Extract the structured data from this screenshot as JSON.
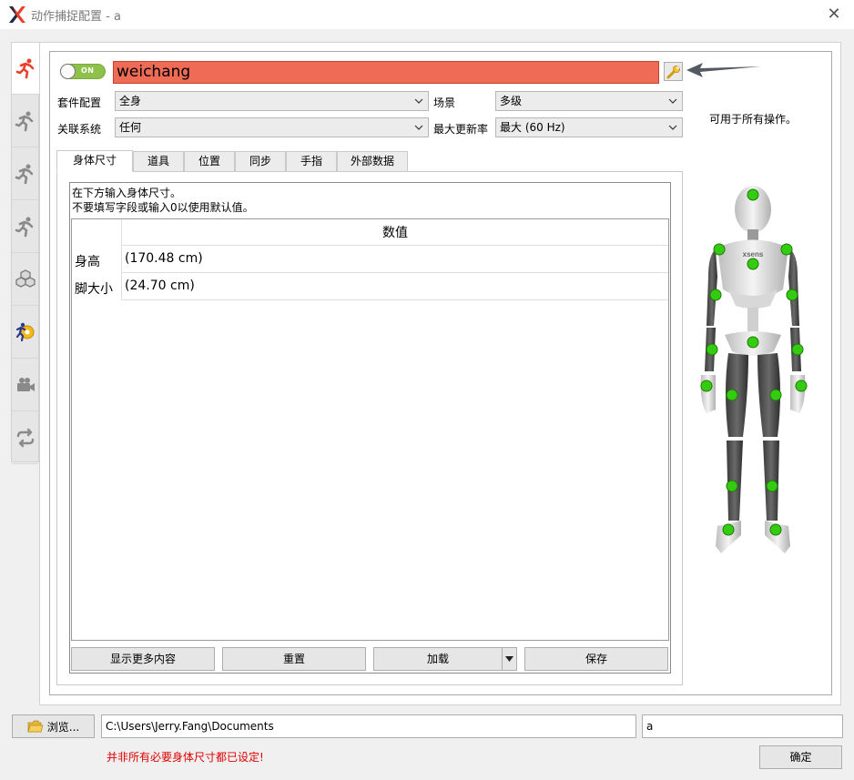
{
  "window": {
    "title": "动作捕捉配置 - a",
    "close_glyph": "✕"
  },
  "side_tabs": [
    {
      "icon": "running-figure-red-icon",
      "active": true
    },
    {
      "icon": "running-figure-gray-icon",
      "active": false
    },
    {
      "icon": "running-figure-gray-icon",
      "active": false
    },
    {
      "icon": "running-figure-gray-icon",
      "active": false
    },
    {
      "icon": "cubes-icon",
      "active": false
    },
    {
      "icon": "running-figure-gear-icon",
      "active": false
    },
    {
      "icon": "video-camera-icon",
      "active": false
    },
    {
      "icon": "sync-arrows-icon",
      "active": false
    }
  ],
  "header": {
    "toggle_label": "ON",
    "name_value": "weichang",
    "name_bg_color": "#ee6b55"
  },
  "config": {
    "suit_label": "套件配置",
    "suit_value": "全身",
    "scene_label": "场景",
    "scene_value": "多级",
    "link_label": "关联系统",
    "link_value": "任何",
    "rate_label": "最大更新率",
    "rate_value": "最大 (60 Hz)"
  },
  "side_hint": "可用于所有操作。",
  "tabs": [
    "身体尺寸",
    "道具",
    "位置",
    "同步",
    "手指",
    "外部数据"
  ],
  "body_tab": {
    "desc_line1": "在下方输入身体尺寸。",
    "desc_line2": "不要填写字段或输入0以使用默认值。",
    "column_header": "数值",
    "rows": [
      {
        "label": "身高",
        "value": "(170.48 cm)"
      },
      {
        "label": "脚大小",
        "value": "(24.70 cm)"
      }
    ],
    "buttons": {
      "more": "显示更多内容",
      "reset": "重置",
      "load": "加载",
      "save": "保存"
    }
  },
  "mannequin": {
    "brand_text": "xsens",
    "sensor_color": "#33cc11"
  },
  "footer": {
    "browse_label": "浏览...",
    "path_value": "C:\\Users\\Jerry.Fang\\Documents",
    "file_value": "a",
    "warning": "并非所有必要身体尺寸都已设定!",
    "warning_color": "#e00000",
    "ok_label": "确定"
  }
}
